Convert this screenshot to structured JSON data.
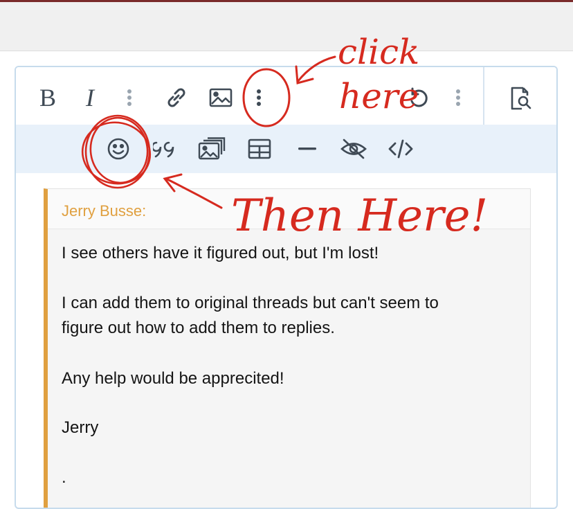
{
  "toolbar": {
    "bold_label": "B",
    "italic_label": "I",
    "row1_icons": [
      "more-vert-icon",
      "link-icon",
      "image-icon",
      "more-vert-icon",
      "undo-icon",
      "more-vert-icon",
      "preview-icon"
    ],
    "row2_icons": [
      "smiley-icon",
      "quote-icon",
      "media-icon",
      "table-icon",
      "horizontal-rule-icon",
      "spoiler-icon",
      "code-icon"
    ]
  },
  "quote": {
    "author": "Jerry Busse:",
    "lines": [
      "I see others have it figured out, but I'm lost!",
      "I can add them to original threads but can't seem to",
      "figure out how to add them to replies.",
      "Any help would be apprecited!",
      "Jerry",
      "."
    ]
  },
  "annotations": {
    "click_line1": "click",
    "click_line2": "here",
    "then_here": "Then Here!"
  },
  "colors": {
    "accent_quote": "#e0a040",
    "annotation_red": "#d62a1f",
    "toolbar_row2_bg": "#e8f1fa",
    "border": "#c6dbec"
  }
}
